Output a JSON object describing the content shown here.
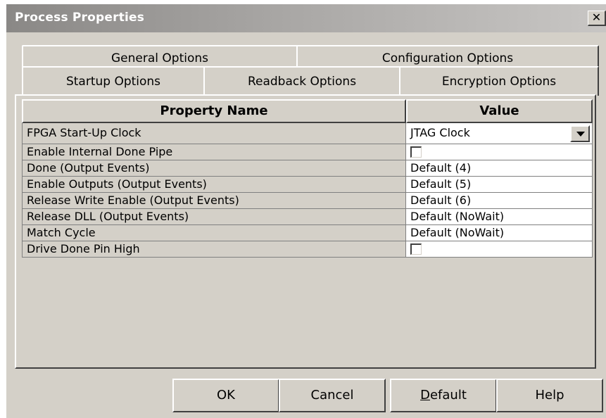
{
  "window": {
    "title": "Process Properties",
    "close_label": "x"
  },
  "tabs_row1": [
    "General Options",
    "Configuration Options"
  ],
  "tabs_row2": [
    "Startup Options",
    "Readback Options",
    "Encryption Options"
  ],
  "active_tab": "Startup Options",
  "grid": {
    "headers": {
      "name": "Property Name",
      "value": "Value"
    },
    "rows": [
      {
        "name": "FPGA Start-Up Clock",
        "value": "JTAG Clock",
        "type": "combo"
      },
      {
        "name": "Enable Internal Done Pipe",
        "value": "",
        "type": "checkbox",
        "checked": false
      },
      {
        "name": "Done (Output Events)",
        "value": "Default (4)",
        "type": "text"
      },
      {
        "name": "Enable Outputs (Output Events)",
        "value": "Default (5)",
        "type": "text"
      },
      {
        "name": "Release Write Enable (Output Events)",
        "value": "Default (6)",
        "type": "text"
      },
      {
        "name": "Release DLL (Output Events)",
        "value": "Default (NoWait)",
        "type": "text"
      },
      {
        "name": "Match Cycle",
        "value": "Default (NoWait)",
        "type": "text"
      },
      {
        "name": "Drive Done Pin High",
        "value": "",
        "type": "checkbox",
        "checked": false
      }
    ]
  },
  "buttons": {
    "ok": "OK",
    "cancel": "Cancel",
    "default_prefix": "D",
    "default_rest": "efault",
    "help": "Help"
  },
  "icons": {
    "combo": "chevron-down-icon",
    "close": "close-icon"
  }
}
